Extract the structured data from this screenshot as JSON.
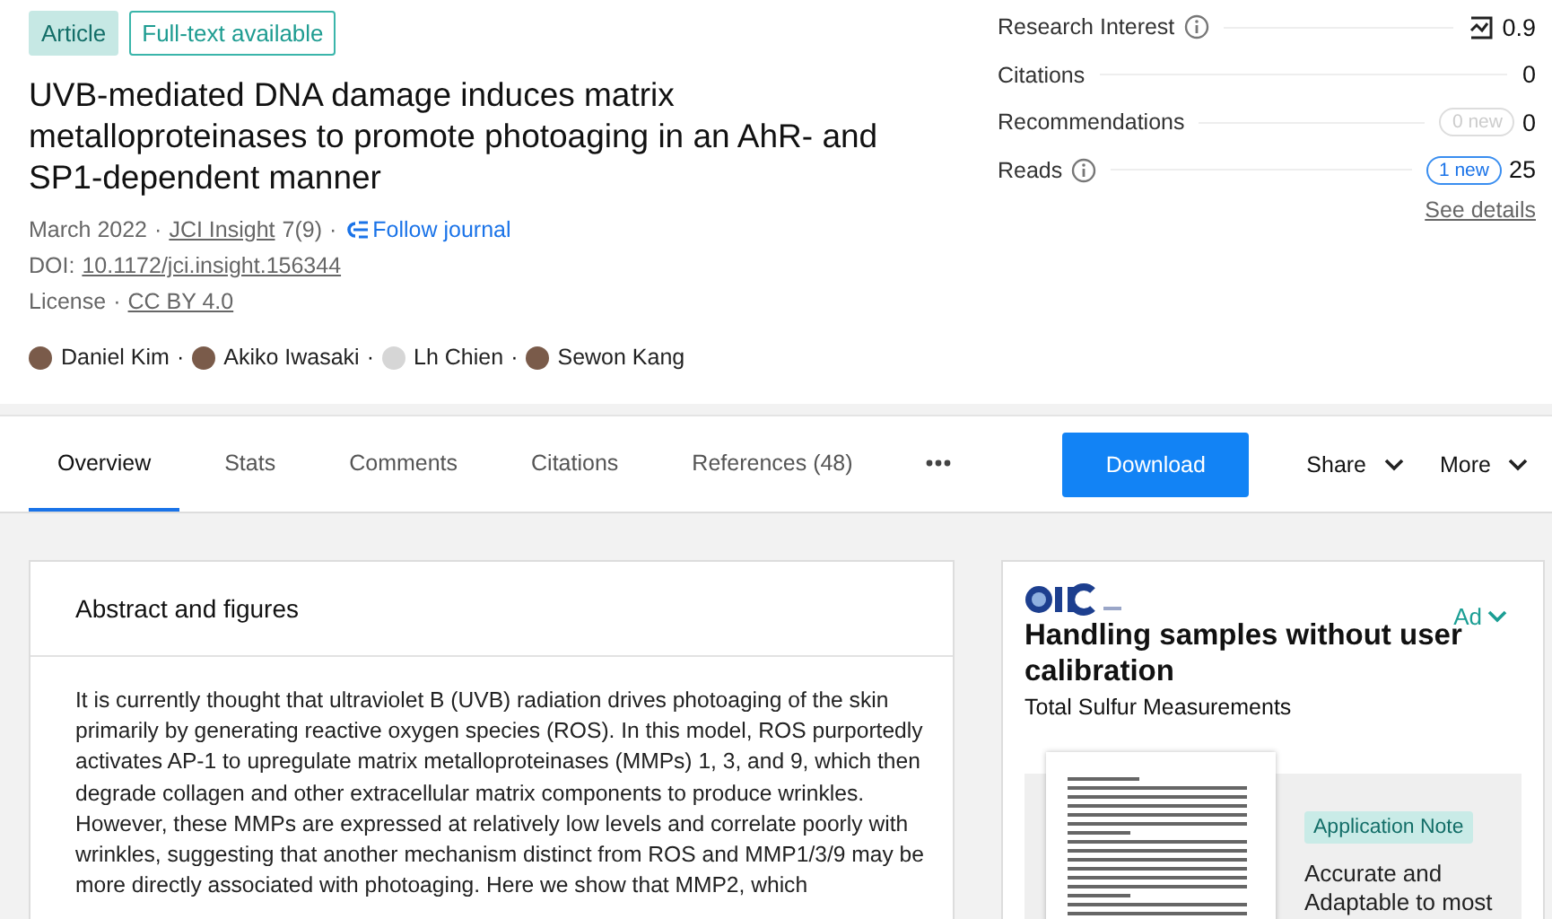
{
  "header": {
    "tags": [
      {
        "label": "Article",
        "kind": "filled"
      },
      {
        "label": "Full-text available",
        "kind": "outline"
      }
    ],
    "title": "UVB-mediated DNA damage induces matrix metalloproteinases to promote photoaging in an AhR- and SP1-dependent manner",
    "date": "March 2022",
    "journal": "JCI Insight",
    "issue": "7(9)",
    "follow": "Follow journal",
    "separator": "·",
    "doi_label": "DOI:",
    "doi": "10.1172/jci.insight.156344",
    "license_label": "License",
    "license": "CC BY 4.0",
    "authors": [
      {
        "name": "Daniel Kim",
        "photo": true
      },
      {
        "name": "Akiko Iwasaki",
        "photo": true
      },
      {
        "name": "Lh Chien",
        "photo": false
      },
      {
        "name": "Sewon Kang",
        "photo": true
      }
    ]
  },
  "stats": {
    "rows": [
      {
        "label": "Research Interest",
        "info": true,
        "trend_icon": true,
        "value": "0.9"
      },
      {
        "label": "Citations",
        "info": false,
        "value": "0"
      },
      {
        "label": "Recommendations",
        "info": false,
        "badge": {
          "text": "0 new",
          "highlighted": false
        },
        "value": "0"
      },
      {
        "label": "Reads",
        "info": true,
        "badge": {
          "text": "1 new",
          "highlighted": true
        },
        "value": "25"
      }
    ],
    "link": "See details"
  },
  "tabs": [
    {
      "label": "Overview",
      "selected": true
    },
    {
      "label": "Stats",
      "selected": false
    },
    {
      "label": "Comments",
      "selected": false
    },
    {
      "label": "Citations",
      "selected": false
    },
    {
      "label": "References (48)",
      "selected": false
    }
  ],
  "actions": {
    "download": "Download",
    "menus": [
      "Share",
      "More"
    ]
  },
  "abstract": {
    "heading": "Abstract and figures",
    "text": "It is currently thought that ultraviolet B (UVB) radiation drives photoaging of the skin primarily by generating reactive oxygen species (ROS). In this model, ROS purportedly activates AP-1 to upregulate matrix metalloproteinases (MMPs) 1, 3, and 9, which then degrade collagen and other extracellular matrix components to produce wrinkles. However, these MMPs are expressed at relatively low levels and correlate poorly with wrinkles, suggesting that another mechanism distinct from ROS and MMP1/3/9 may be more directly associated with photoaging. Here we show that MMP2, which"
  },
  "ad": {
    "label": "Ad",
    "headline": "Handling samples without user calibration",
    "subtitle": "Total Sulfur Measurements",
    "tag": "Application Note",
    "body": "Accurate and Adaptable to most"
  }
}
